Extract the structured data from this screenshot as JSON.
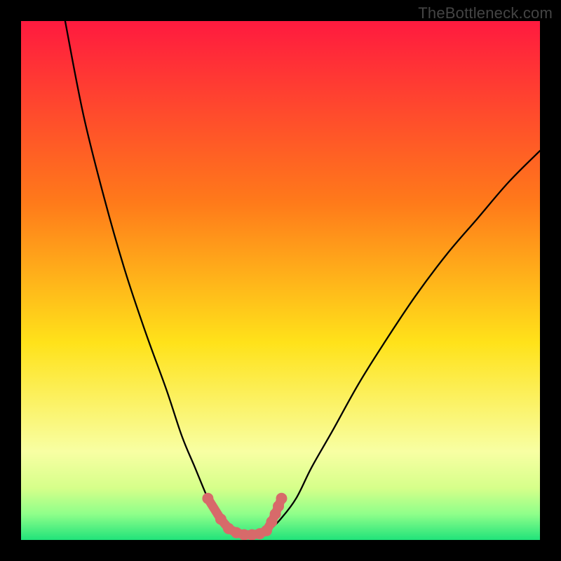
{
  "watermark": "TheBottleneck.com",
  "colors": {
    "frame": "#000000",
    "gradient_top": "#ff1a3f",
    "gradient_mid_1": "#ff7a1a",
    "gradient_mid_2": "#ffe21a",
    "gradient_low": "#f8ffa3",
    "gradient_band_1": "#d6ff8a",
    "gradient_band_2": "#8fff8a",
    "gradient_bottom": "#20e37a",
    "curve": "#000000",
    "marker_fill": "#d76a6a",
    "marker_stroke": "#c94f4f"
  },
  "chart_data": {
    "type": "line",
    "title": "",
    "xlabel": "",
    "ylabel": "",
    "xlim": [
      0,
      100
    ],
    "ylim": [
      0,
      100
    ],
    "series": [
      {
        "name": "left-branch",
        "x": [
          8.5,
          12,
          16,
          20,
          24,
          28,
          31,
          33.5,
          36,
          38,
          40
        ],
        "y": [
          100,
          82,
          66,
          52,
          40,
          29,
          20,
          14,
          8,
          4,
          2
        ]
      },
      {
        "name": "right-branch",
        "x": [
          48,
          50,
          53,
          56,
          60,
          65,
          70,
          76,
          82,
          88,
          94,
          100
        ],
        "y": [
          2,
          4,
          8,
          14,
          21,
          30,
          38,
          47,
          55,
          62,
          69,
          75
        ]
      }
    ],
    "markers": {
      "name": "bottom-markers",
      "points": [
        {
          "x": 36.0,
          "y": 8.0
        },
        {
          "x": 38.5,
          "y": 4.0
        },
        {
          "x": 40.0,
          "y": 2.2
        },
        {
          "x": 41.5,
          "y": 1.4
        },
        {
          "x": 43.0,
          "y": 1.0
        },
        {
          "x": 44.5,
          "y": 1.0
        },
        {
          "x": 46.0,
          "y": 1.2
        },
        {
          "x": 47.3,
          "y": 1.8
        },
        {
          "x": 48.3,
          "y": 3.5
        },
        {
          "x": 49.0,
          "y": 5.0
        },
        {
          "x": 49.6,
          "y": 6.5
        },
        {
          "x": 50.2,
          "y": 8.0
        }
      ]
    }
  }
}
